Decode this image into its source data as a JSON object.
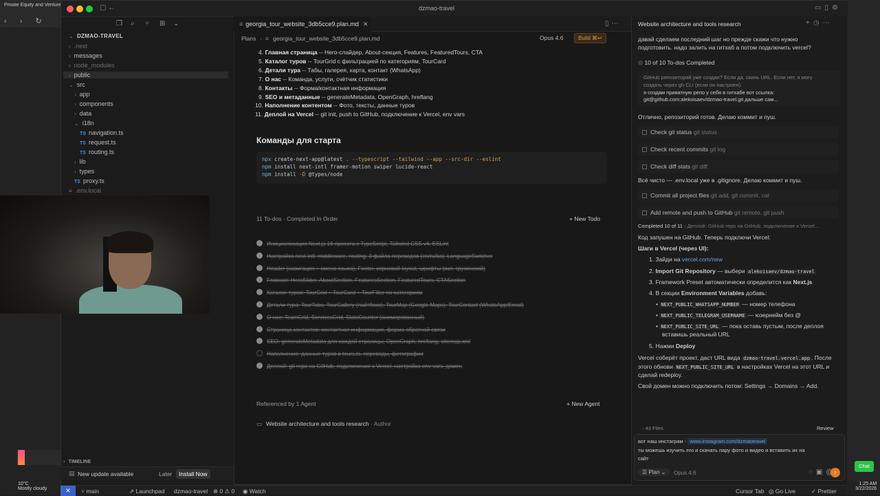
{
  "browser": {
    "tab_title": "Private Equity and Venture"
  },
  "window": {
    "title": "dzmao-travel"
  },
  "colors": {
    "accent": "#3a63c9",
    "build": "#d99a4a",
    "chat_green": "#2ec24a",
    "link": "#6aa3e0"
  },
  "sidebar": {
    "project": "DZMAO-TRAVEL",
    "items": [
      {
        "label": ".next",
        "kind": "folder",
        "dim": true
      },
      {
        "label": "messages",
        "kind": "folder"
      },
      {
        "label": "node_modules",
        "kind": "folder",
        "dim": true
      },
      {
        "label": "public",
        "kind": "folder",
        "selected": true
      },
      {
        "label": "src",
        "kind": "folder-open"
      },
      {
        "label": "app",
        "kind": "folder"
      },
      {
        "label": "components",
        "kind": "folder"
      },
      {
        "label": "data",
        "kind": "folder"
      },
      {
        "label": "i18n",
        "kind": "folder-open"
      },
      {
        "label": "navigation.ts",
        "kind": "ts"
      },
      {
        "label": "request.ts",
        "kind": "ts"
      },
      {
        "label": "routing.ts",
        "kind": "ts"
      },
      {
        "label": "lib",
        "kind": "folder"
      },
      {
        "label": "types",
        "kind": "folder"
      },
      {
        "label": "proxy.ts",
        "kind": "ts"
      },
      {
        "label": ".env.local",
        "kind": "file",
        "dim": true
      }
    ],
    "timeline": "TIMELINE",
    "update": {
      "text": "New update available",
      "later": "Later",
      "install": "Install Now"
    }
  },
  "editor": {
    "tab": "georgia_tour_website_3db5cce9.plan.md",
    "breadcrumb": [
      "Plans",
      "georgia_tour_website_3db5cce9.plan.md"
    ],
    "model": "Opus 4.6",
    "build": "Build ⌘↩",
    "plan_list": [
      {
        "n": "4.",
        "bold": "Главная страница",
        "rest": " -- Hero-слайдер, About-секция, Features, FeaturedTours, CTA"
      },
      {
        "n": "5.",
        "bold": "Каталог туров",
        "rest": " -- TourGrid с фильтрацией по категориям, TourCard"
      },
      {
        "n": "6.",
        "bold": "Детали тура",
        "rest": " -- Табы, галерея, карта, контакт (WhatsApp)"
      },
      {
        "n": "7.",
        "bold": "О нас",
        "rest": " -- Команда, услуги, счётчик статистики"
      },
      {
        "n": "8.",
        "bold": "Контакты",
        "rest": " -- Форма/контактная информация"
      },
      {
        "n": "9.",
        "bold": "SEO и метаданные",
        "rest": " -- generateMetadata, OpenGraph, hreflang"
      },
      {
        "n": "10.",
        "bold": "Наполнение контентом",
        "rest": " -- Фото, тексты, данные туров"
      },
      {
        "n": "11.",
        "bold": "Деплой на Vercel",
        "rest": " -- git init, push to GitHub, подключение к Vercel, env vars"
      }
    ],
    "commands_heading": "Команды для старта",
    "code": [
      "npx create-next-app@latest . --typescript --tailwind --app --src-dir --eslint",
      "npm install next-intl framer-motion swiper lucide-react",
      "npm install -D @types/node"
    ],
    "todos_heading": "11 To-dos · Completed In Order",
    "new_todo": "+ New Todo",
    "todos": [
      "Инициализация Next.js 16 проекта с TypeScript, Tailwind CSS v4, ESLint",
      "Настройка next-intl: middleware, routing, 3 файла переводов (en/ru/ka), LanguageSwitcher",
      "Header (навигация + смена языка), Footer, корневой layout, шрифты (вкл. грузинский)",
      "Главная: HeroSlider, AboutSection, FeaturesSection, FeaturedTours, CTASection",
      "Каталог туров: TourGrid + TourCard + TourFilter по категориям",
      "Детали тура: TourTabs, TourGallery (лайтбокс), TourMap (Google Maps), TourContact (WhatsApp/Email)",
      "О нас: TeamGrid, ServicesGrid, StatsCounter (анимированный)",
      "Страница контактов: контактная информация, форма обратной связи",
      "SEO: generateMetadata для каждой страницы, OpenGraph, hreflang, sitemap.xml",
      "Наполнение: данные туров в tours.ts, переводы, фотографии",
      "Деплой: git repo на GitHub, подключение к Vercel, настройка env vars, домен"
    ],
    "referenced_heading": "Referenced by 1 Agent",
    "new_agent": "+ New Agent",
    "ref_agent": "Website architecture and tools research",
    "ref_role": " · Author"
  },
  "panel": {
    "title": "Website architecture and tools research",
    "user_msg": [
      "давай сделаем последний шаг но прежде скажи что нужно",
      "подготовить. надо залить на гитхаб а потом подключить vercel?"
    ],
    "todos_done": "10 of 10 To-dos Completed",
    "quote": [
      "GitHub репозиторий уже создан? Если да, скинь URL. Если нет, я могу",
      "создать через  gh  CLI (если он настроен)."
    ],
    "user_reply": [
      "я создам приватную репо у себя в гитхабе вот ссылка:",
      "git@github.com:alekoisaev/dzmao-travel.git дальше сам..."
    ],
    "ok_line": "Отлично, репозиторий готов. Делаю коммит и пуш.",
    "tool_rows": [
      {
        "label": "Check git status",
        "sub": "git status"
      },
      {
        "label": "Check recent commits",
        "sub": "git log"
      },
      {
        "label": "Check diff stats",
        "sub": "git diff"
      }
    ],
    "clean_line": "Всё чисто — .env.local уже в .gitignore. Делаю коммит и пуш.",
    "tool_rows2": [
      {
        "label": "Commit all project files",
        "sub": "git add, git commit, cat"
      },
      {
        "label": "Add remote and push to GitHub",
        "sub": "git remote, git push"
      }
    ],
    "completed_line": "Completed 10 of 11",
    "completed_sub": "Деплой: GitHub repo на GitHub, подключение к Vercel...",
    "pushed": "Код запушен на GitHub. Теперь подключи Vercel:",
    "steps_head": "Шаги в Vercel (через UI):",
    "step1_a": "1. Зайди на ",
    "step1_link": "vercel.com/new",
    "step2_a": "2. ",
    "step2_b": "Import Git Repository",
    "step2_c": " — выбери ",
    "step2_code": "alekoisaev/dzmao-travel",
    "step3_a": "3. Framework Preset автоматически определится как ",
    "step3_b": "Next.js",
    "step4_a": "4. В секции ",
    "step4_b": "Environment Variables",
    "step4_c": " добавь:",
    "env1_code": "NEXT_PUBLIC_WHATSAPP_NUMBER",
    "env1_text": " — номер телефона",
    "env2_code": "NEXT_PUBLIC_TELEGRAM_USERNAME",
    "env2_text": " — юзернейм без @",
    "env3_code": "NEXT_PUBLIC_SITE_URL",
    "env3_text": " — пока оставь пустым, после деплоя",
    "env3_text2": "вставишь реальный URL",
    "step5_a": "5. Нажми ",
    "step5_b": "Deploy",
    "final1_a": "Vercel соберёт проект, даст URL вида ",
    "final1_code": "dzmao-travel.vercel.app",
    "final1_b": ". После",
    "final2_a": "этого обнови ",
    "final2_code": "NEXT_PUBLIC_SITE_URL",
    "final2_b": " в настройках Vercel на этот URL и",
    "final3": "сделай redeploy.",
    "domain_line": "Свой домен можно подключить потом: Settings → Domains → Add.",
    "files": "43 Files",
    "review": "Review",
    "input_a": "вот наш инстаграм - ",
    "input_link": "www.instagram.com/dzmaotravel",
    "input_b": "ты можешь изучить его и скачать пару фото и видео и вставить их на",
    "input_c": "сайт",
    "mode": "Plan",
    "mode_model": "Opus 4.6",
    "chat": "Chat"
  },
  "statusbar": {
    "branch": "main",
    "launchpad": "Launchpad",
    "project": "dzmao-travel",
    "problems": "⊗ 0 ⚠ 0",
    "watch": "Watch",
    "cursor_tab": "Cursor Tab",
    "go_live": "Go Live",
    "prettier": "Prettier"
  },
  "taskbar": {
    "temp": "10°C",
    "weather": "Mostly cloudy",
    "time": "1:25 AM",
    "date": "3/22/2026"
  }
}
